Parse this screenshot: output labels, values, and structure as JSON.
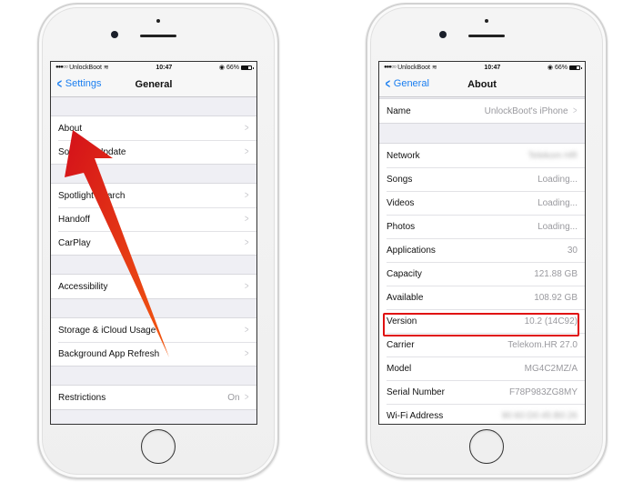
{
  "left_phone": {
    "status": {
      "carrier": "UnlockBoot",
      "signal_dots": "●●●○○",
      "time": "10:47",
      "battery": "66%"
    },
    "nav": {
      "back_label": "Settings",
      "title": "General"
    },
    "groups": [
      [
        {
          "label": "About",
          "value": ""
        },
        {
          "label": "Software Update",
          "value": ""
        }
      ],
      [
        {
          "label": "Spotlight Search",
          "value": ""
        },
        {
          "label": "Handoff",
          "value": ""
        },
        {
          "label": "CarPlay",
          "value": ""
        }
      ],
      [
        {
          "label": "Accessibility",
          "value": ""
        }
      ],
      [
        {
          "label": "Storage & iCloud Usage",
          "value": ""
        },
        {
          "label": "Background App Refresh",
          "value": ""
        }
      ],
      [
        {
          "label": "Restrictions",
          "value": "On"
        }
      ]
    ]
  },
  "right_phone": {
    "status": {
      "carrier": "UnlockBoot",
      "signal_dots": "●●●○○",
      "time": "10:47",
      "battery": "66%"
    },
    "nav": {
      "back_label": "General",
      "title": "About"
    },
    "name_row": {
      "label": "Name",
      "value": "UnlockBoot's iPhone"
    },
    "info_rows": [
      {
        "label": "Network",
        "value": "Telekom HR"
      },
      {
        "label": "Songs",
        "value": "Loading..."
      },
      {
        "label": "Videos",
        "value": "Loading..."
      },
      {
        "label": "Photos",
        "value": "Loading..."
      },
      {
        "label": "Applications",
        "value": "30"
      },
      {
        "label": "Capacity",
        "value": "121.88 GB"
      },
      {
        "label": "Available",
        "value": "108.92 GB"
      },
      {
        "label": "Version",
        "value": "10.2 (14C92)"
      },
      {
        "label": "Carrier",
        "value": "Telekom.HR 27.0"
      },
      {
        "label": "Model",
        "value": "MG4C2MZ/A"
      },
      {
        "label": "Serial Number",
        "value": "F78P983ZG8MY"
      },
      {
        "label": "Wi-Fi Address",
        "value": "90:60:D0:45:B0:26"
      }
    ],
    "highlighted_row": "Version"
  },
  "annotation": {
    "arrow_color_start": "#d4101a",
    "arrow_color_end": "#f25a10",
    "highlight_color": "#e01010"
  },
  "colors": {
    "ios_blue": "#1a7ef0",
    "grouped_background": "#efeff4"
  }
}
